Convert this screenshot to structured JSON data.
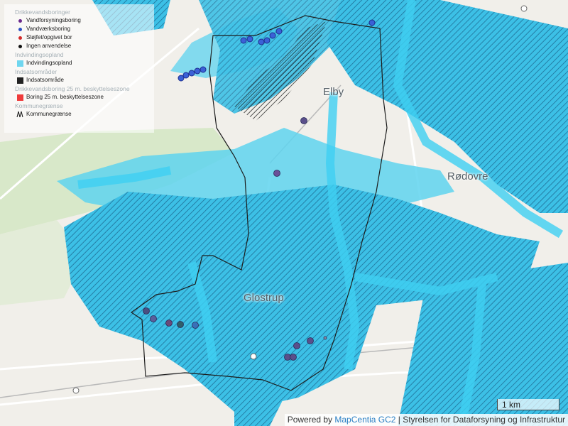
{
  "legend": {
    "groups": [
      {
        "title": "Drikkevandsboringer",
        "items": [
          {
            "label": "Vandforsyningsboring",
            "color": "#6b2a8c",
            "shape": "dot"
          },
          {
            "label": "Vandværksboring",
            "color": "#2a4fc4",
            "shape": "dot"
          },
          {
            "label": "Sløjfet/opgivet bor",
            "color": "#d42a2a",
            "shape": "dot"
          },
          {
            "label": "Ingen anvendelse",
            "color": "#111111",
            "shape": "dot"
          }
        ]
      },
      {
        "title": "Indvindingsopland",
        "items": [
          {
            "label": "Indvindingsopland",
            "color": "#6fd6ef",
            "shape": "square"
          }
        ]
      },
      {
        "title": "Indsatsområder",
        "items": [
          {
            "label": "Indsatsområde",
            "color": "#222222",
            "shape": "square"
          }
        ]
      },
      {
        "title": "Drikkevandsboring 25 m. beskyttelseszone",
        "items": [
          {
            "label": "Boring 25 m. beskyttelseszone",
            "color": "#ef3b3b",
            "shape": "square"
          }
        ]
      },
      {
        "title": "Kommunegrænse",
        "items": [
          {
            "label": "Kommunegrænse",
            "color": "#111111",
            "shape": "line"
          }
        ]
      }
    ]
  },
  "places": [
    {
      "name": "Glostrup"
    },
    {
      "name": "Rødovre"
    },
    {
      "name": "Elby"
    }
  ],
  "scale_bar": {
    "label": "1 km"
  },
  "attribution": {
    "prefix": "Powered by ",
    "link_text": "MapCentia GC2",
    "suffix": " | Styrelsen for Dataforsyning og Infrastruktur"
  },
  "colors": {
    "catchment_fill": "#3cc0e6",
    "catchment_light": "#7fdcf2",
    "hatch": "#1a6f96",
    "base": "#f2efe9",
    "green": "#dcebd0",
    "boundary": "#222222",
    "well_purple": "#5a3d8a",
    "well_blue": "#2f57c8"
  }
}
